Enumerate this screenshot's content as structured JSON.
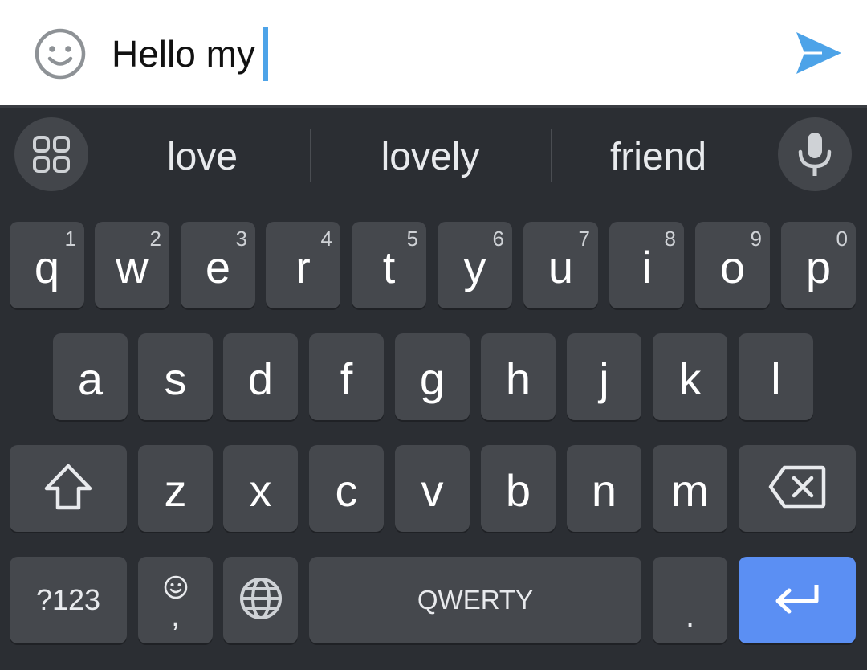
{
  "input": {
    "text": "Hello my",
    "emoji_icon": "smiley-face-icon",
    "send_icon": "send-arrow-icon"
  },
  "suggestions": {
    "left_icon": "apps-grid-icon",
    "right_icon": "microphone-icon",
    "items": [
      "love",
      "lovely",
      "friend"
    ]
  },
  "keys": {
    "row1": [
      {
        "ch": "q",
        "hint": "1"
      },
      {
        "ch": "w",
        "hint": "2"
      },
      {
        "ch": "e",
        "hint": "3"
      },
      {
        "ch": "r",
        "hint": "4"
      },
      {
        "ch": "t",
        "hint": "5"
      },
      {
        "ch": "y",
        "hint": "6"
      },
      {
        "ch": "u",
        "hint": "7"
      },
      {
        "ch": "i",
        "hint": "8"
      },
      {
        "ch": "o",
        "hint": "9"
      },
      {
        "ch": "p",
        "hint": "0"
      }
    ],
    "row2": [
      "a",
      "s",
      "d",
      "f",
      "g",
      "h",
      "j",
      "k",
      "l"
    ],
    "row3": [
      "z",
      "x",
      "c",
      "v",
      "b",
      "n",
      "m"
    ],
    "symbols_label": "?123",
    "comma_label": ",",
    "space_label": "QWERTY",
    "period_label": ".",
    "shift_icon": "shift-arrow-icon",
    "backspace_icon": "backspace-icon",
    "globe_icon": "globe-icon",
    "enter_icon": "enter-return-icon"
  },
  "colors": {
    "caret": "#4da3e8",
    "send": "#4da3e8",
    "enter_key": "#5b8ff3",
    "keyboard_bg": "#2b2e33",
    "key_bg": "#45484d"
  }
}
